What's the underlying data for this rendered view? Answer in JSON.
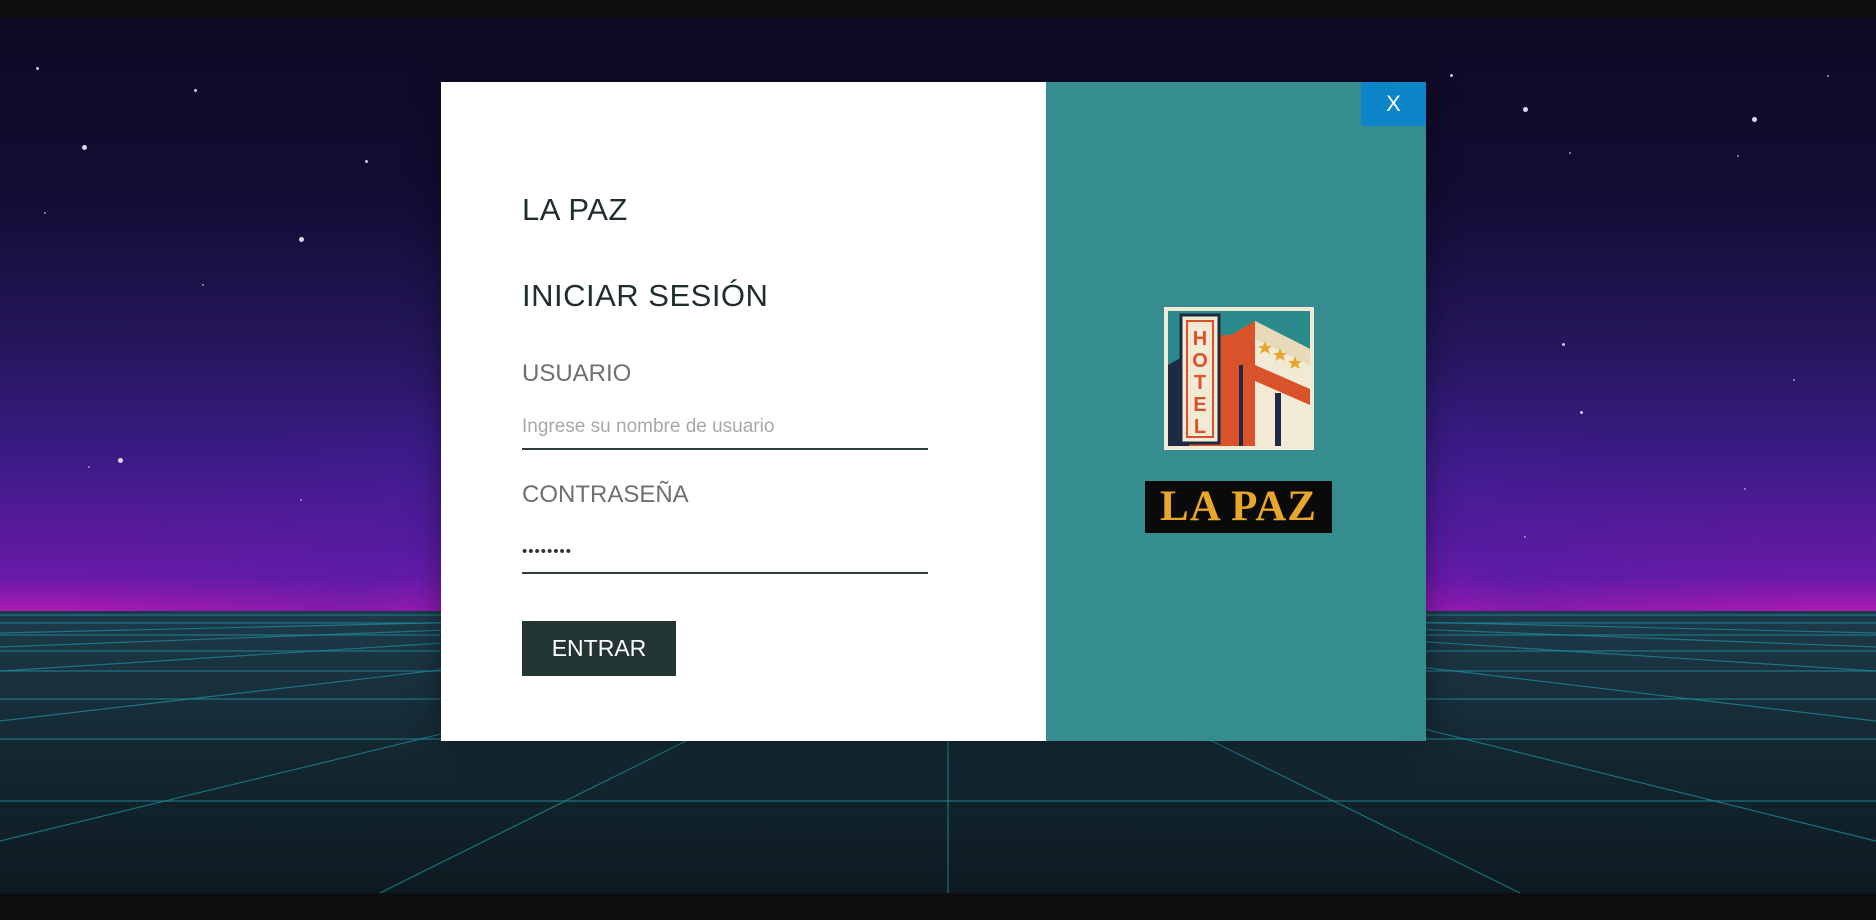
{
  "modal": {
    "brand": "LA PAZ",
    "heading": "INICIAR SESIÓN",
    "close_label": "X",
    "form": {
      "username_label": "USUARIO",
      "username_placeholder": "Ingrese su nombre de usuario",
      "username_value": "",
      "password_label": "CONTRASEÑA",
      "password_value": "••••••••",
      "submit_label": "ENTRAR"
    },
    "logo": {
      "icon": "hotel-building-icon",
      "sign_text": "HOTEL",
      "name_text": "LA PAZ"
    }
  },
  "colors": {
    "panel_teal": "#368d8f",
    "button_dark": "#223533",
    "close_blue": "#0d85c9",
    "logo_gold": "#e8a72a"
  }
}
